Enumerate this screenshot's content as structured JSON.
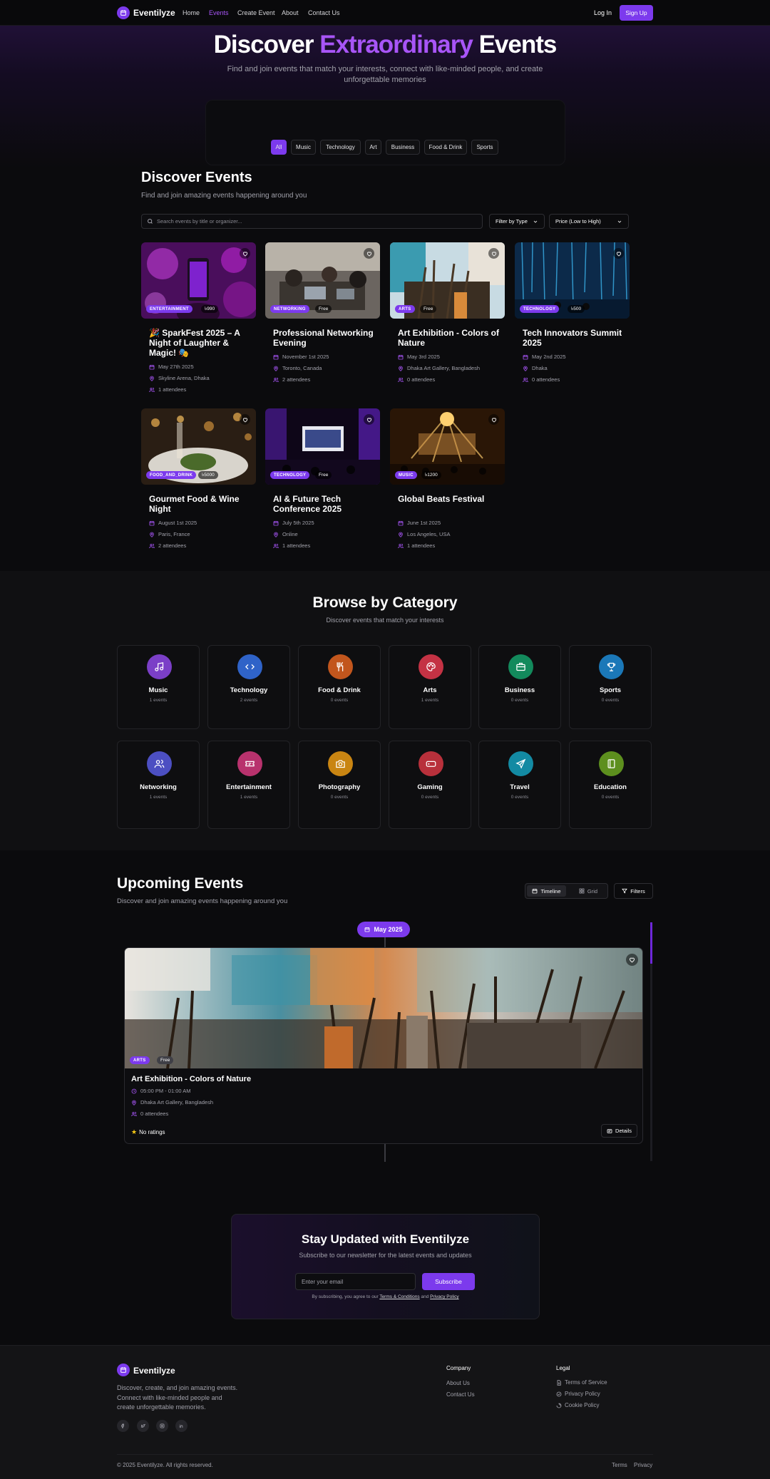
{
  "nav": {
    "brand": "Eventilyze",
    "links": [
      "Home",
      "Events",
      "Create Event",
      "About",
      "Contact Us"
    ],
    "login": "Log In",
    "signup": "Sign Up"
  },
  "hero": {
    "title_1": "Discover ",
    "title_2": "Extraordinary",
    "title_3": " Events",
    "subtitle_1": "Find and join events that match your interests, connect with like-minded people, and create",
    "subtitle_2": "unforgettable memories",
    "filters": [
      "All",
      "Music",
      "Technology",
      "Art",
      "Business",
      "Food & Drink",
      "Sports"
    ]
  },
  "discover": {
    "title": "Discover Events",
    "subtitle": "Find and join amazing events happening around you",
    "search_placeholder": "Search events by title or organizer...",
    "filter_type": "Filter by Type",
    "sort": "Price (Low to High)"
  },
  "events": [
    {
      "badge": "ENTERTAINMENT",
      "price": "৳990",
      "title": "🎉 SparkFest 2025 – A Night of Laughter & Magic! 🎭",
      "date": "May 27th 2025",
      "location": "Skyline Arena, Dhaka",
      "attendees": "1 attendees"
    },
    {
      "badge": "NETWORKING",
      "price": "Free",
      "title": "Professional Networking Evening",
      "date": "November 1st 2025",
      "location": "Toronto, Canada",
      "attendees": "2 attendees"
    },
    {
      "badge": "ARTS",
      "price": "Free",
      "title": "Art Exhibition - Colors of Nature",
      "date": "May 3rd 2025",
      "location": "Dhaka Art Gallery, Bangladesh",
      "attendees": "0 attendees"
    },
    {
      "badge": "TECHNOLOGY",
      "price": "৳500",
      "title": "Tech Innovators Summit 2025",
      "date": "May 2nd 2025",
      "location": "Dhaka",
      "attendees": "0 attendees"
    },
    {
      "badge": "FOOD_AND_DRINK",
      "price": "৳5000",
      "title": "Gourmet Food & Wine Night",
      "date": "August 1st 2025",
      "location": "Paris, France",
      "attendees": "2 attendees"
    },
    {
      "badge": "TECHNOLOGY",
      "price": "Free",
      "title": "AI & Future Tech Conference 2025",
      "date": "July 5th 2025",
      "location": "Online",
      "attendees": "1 attendees"
    },
    {
      "badge": "MUSIC",
      "price": "৳1200",
      "title": "Global Beats Festival",
      "date": "June 1st 2025",
      "location": "Los Angeles, USA",
      "attendees": "1 attendees"
    }
  ],
  "browse": {
    "title": "Browse by Category",
    "subtitle": "Discover events that match your interests",
    "categories": [
      {
        "name": "Music",
        "count": "1 events",
        "color": "#7b3fc7",
        "icon": "music-icon"
      },
      {
        "name": "Technology",
        "count": "2 events",
        "color": "#2f63c8",
        "icon": "code-icon"
      },
      {
        "name": "Food & Drink",
        "count": "0 events",
        "color": "#c2561d",
        "icon": "utensils-icon"
      },
      {
        "name": "Arts",
        "count": "1 events",
        "color": "#c43244",
        "icon": "palette-icon"
      },
      {
        "name": "Business",
        "count": "0 events",
        "color": "#138a5c",
        "icon": "briefcase-icon"
      },
      {
        "name": "Sports",
        "count": "0 events",
        "color": "#1b78b8",
        "icon": "trophy-icon"
      },
      {
        "name": "Networking",
        "count": "1 events",
        "color": "#4c4fc2",
        "icon": "users-icon"
      },
      {
        "name": "Entertainment",
        "count": "1 events",
        "color": "#b8326d",
        "icon": "ticket-icon"
      },
      {
        "name": "Photography",
        "count": "0 events",
        "color": "#c98512",
        "icon": "camera-icon"
      },
      {
        "name": "Gaming",
        "count": "0 events",
        "color": "#b8303b",
        "icon": "gamepad-icon"
      },
      {
        "name": "Travel",
        "count": "0 events",
        "color": "#138aa3",
        "icon": "plane-icon"
      },
      {
        "name": "Education",
        "count": "0 events",
        "color": "#5d8f1e",
        "icon": "book-icon"
      }
    ]
  },
  "upcoming": {
    "title": "Upcoming Events",
    "subtitle": "Discover and join amazing events happening around you",
    "timeline": "Timeline",
    "grid": "Grid",
    "filters": "Filters",
    "month": "May 2025",
    "event": {
      "badge": "ARTS",
      "price": "Free",
      "title": "Art Exhibition - Colors of Nature",
      "time": "05:00 PM - 01:00 AM",
      "location": "Dhaka Art Gallery, Bangladesh",
      "attendees": "0 attendees",
      "ratings": "No ratings",
      "details": "Details"
    }
  },
  "newsletter": {
    "title": "Stay Updated with Eventilyze",
    "subtitle": "Subscribe to our newsletter for the latest events and updates",
    "placeholder": "Enter your email",
    "button": "Subscribe",
    "consent_1": "By subscribing, you agree to our ",
    "terms": "Terms & Conditions",
    "and": " and ",
    "privacy": "Privacy Policy"
  },
  "footer": {
    "brand": "Eventilyze",
    "tagline_1": "Discover, create, and join amazing events.",
    "tagline_2": "Connect with like-minded people and",
    "tagline_3": "create unforgettable memories.",
    "company": "Company",
    "company_links": [
      "About Us",
      "Contact Us"
    ],
    "legal": "Legal",
    "legal_links": [
      "Terms of Service",
      "Privacy Policy",
      "Cookie Policy"
    ],
    "copyright": "© 2025 Eventilyze. All rights reserved.",
    "bottom_links": [
      "Terms",
      "Privacy"
    ]
  },
  "colors": {
    "accent": "#7c3aed",
    "accent_light": "#a855f7"
  }
}
